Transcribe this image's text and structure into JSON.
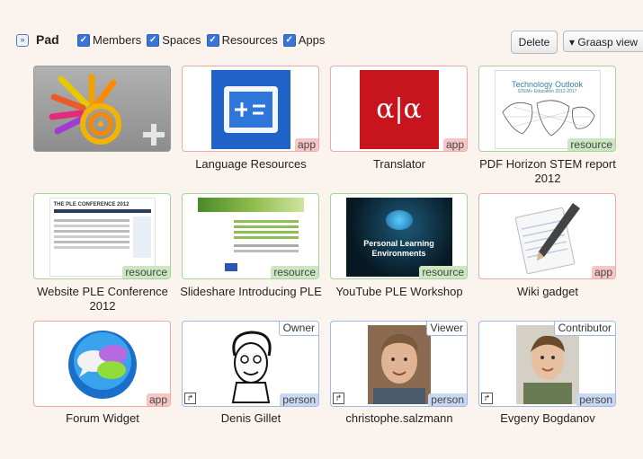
{
  "toolbar": {
    "collapse_glyph": "»",
    "title": "Pad",
    "filters": [
      {
        "label": "Members",
        "checked": true
      },
      {
        "label": "Spaces",
        "checked": true
      },
      {
        "label": "Resources",
        "checked": true
      },
      {
        "label": "Apps",
        "checked": true
      }
    ],
    "delete_label": "Delete",
    "view_label": "▾ Graasp view"
  },
  "items": [
    {
      "label": "",
      "badge": "",
      "kind": "plain",
      "thumbnail": "Graasp logo with add symbol"
    },
    {
      "label": "Language Resources",
      "badge": "app",
      "kind": "app"
    },
    {
      "label": "Translator",
      "badge": "app",
      "kind": "app",
      "thumb_text": "α|α"
    },
    {
      "label": "PDF Horizon STEM report 2012",
      "badge": "resource",
      "kind": "resource",
      "thumb_title": "Technology Outlook",
      "thumb_sub": "STEM+ Education 2012-2017"
    },
    {
      "label": "Website PLE Conference 2012",
      "badge": "resource",
      "kind": "resource",
      "thumb_title": "THE PLE CONFERENCE 2012"
    },
    {
      "label": "Slideshare Introducing PLE",
      "badge": "resource",
      "kind": "resource"
    },
    {
      "label": "YouTube PLE Workshop",
      "badge": "resource",
      "kind": "resource",
      "thumb_title": "Personal Learning Environments"
    },
    {
      "label": "Wiki gadget",
      "badge": "app",
      "kind": "app"
    },
    {
      "label": "Forum Widget",
      "badge": "app",
      "kind": "app"
    },
    {
      "label": "Denis Gillet",
      "badge": "person",
      "kind": "person",
      "role": "Owner"
    },
    {
      "label": "christophe.salzmann",
      "badge": "person",
      "kind": "person",
      "role": "Viewer"
    },
    {
      "label": "Evgeny Bogdanov",
      "badge": "person",
      "kind": "person",
      "role": "Contributor"
    }
  ]
}
